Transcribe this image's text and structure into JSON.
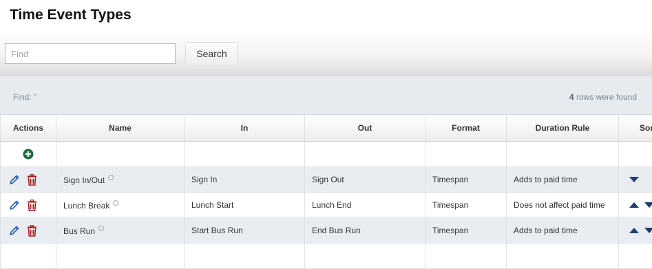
{
  "page": {
    "title": "Time Event Types"
  },
  "search": {
    "placeholder": "Find",
    "value": "",
    "button_label": "Search"
  },
  "info": {
    "find_text": "Find: ''",
    "rows_count": "4",
    "rows_suffix": " rows were found"
  },
  "table": {
    "columns": [
      "Actions",
      "Name",
      "In",
      "Out",
      "Format",
      "Duration Rule",
      "Sort"
    ],
    "rows": [
      {
        "name": "Sign In/Out",
        "in": "Sign In",
        "out": "Sign Out",
        "format": "Timespan",
        "duration_rule": "Adds to paid time",
        "sort": [
          "down"
        ]
      },
      {
        "name": "Lunch Break",
        "in": "Lunch Start",
        "out": "Lunch End",
        "format": "Timespan",
        "duration_rule": "Does not affect paid time",
        "sort": [
          "up",
          "down"
        ]
      },
      {
        "name": "Bus Run",
        "in": "Start Bus Run",
        "out": "End Bus Run",
        "format": "Timespan",
        "duration_rule": "Adds to paid time",
        "sort": [
          "up",
          "down"
        ]
      }
    ]
  },
  "icons": {
    "add": "plus-circle-icon",
    "edit": "pencil-icon",
    "delete": "trash-icon",
    "settings": "gear-icon",
    "sort_up": "arrow-up-icon",
    "sort_down": "arrow-down-icon"
  },
  "colors": {
    "add_green": "#1e6b3a",
    "edit_blue": "#2a5db0",
    "delete_red": "#a4161a",
    "sort_navy": "#1e3f6e",
    "row_alt": "#e9edf2",
    "info_text": "#7b8795"
  }
}
